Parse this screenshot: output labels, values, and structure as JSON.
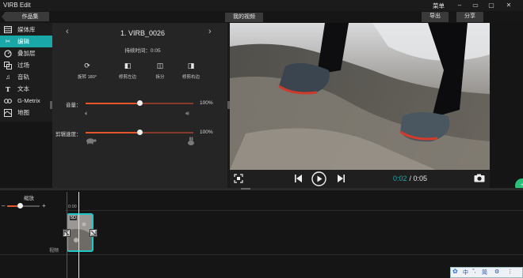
{
  "app": {
    "title": "VIRB Edit"
  },
  "window": {
    "menu_label": "菜单",
    "minimize": "–",
    "restore": "▭",
    "maximize": "▢",
    "close": "✕"
  },
  "tabs": {
    "back_label": "作品集",
    "my_videos": "我的视频",
    "export": "导出",
    "share": "分享"
  },
  "sidebar": {
    "items": [
      {
        "label": "媒体库",
        "icon": "media-library-icon",
        "active": false
      },
      {
        "label": "编辑",
        "icon": "scissors-icon",
        "active": true
      },
      {
        "label": "叠加层",
        "icon": "gauge-icon",
        "active": false
      },
      {
        "label": "过场",
        "icon": "transition-icon",
        "active": false
      },
      {
        "label": "音轨",
        "icon": "music-icon",
        "active": false
      },
      {
        "label": "文本",
        "icon": "text-icon",
        "active": false
      },
      {
        "label": "G-Metrix",
        "icon": "gmetrix-icon",
        "active": false
      },
      {
        "label": "地图",
        "icon": "map-icon",
        "active": false
      }
    ]
  },
  "editor": {
    "clip_title": "1. VIRB_0026",
    "duration": "持续时间：0:05",
    "tools": [
      "旋转 180°",
      "修剪左边",
      "拆分",
      "修剪右边"
    ],
    "volume": {
      "label": "音量：",
      "value": "100%",
      "fraction": 0.5
    },
    "speed": {
      "label": "剪辑速度：",
      "value": "100%",
      "fraction": 0.5
    }
  },
  "player": {
    "current_time": "0:02",
    "total_time": " / 0:05"
  },
  "timeline": {
    "zoom_label": "缩放",
    "zoom_fraction": 0.4,
    "time_marker": "0:00",
    "track_label": "视频",
    "clip_badge": "5D"
  },
  "taskbar": {
    "items": [
      "中",
      "°,",
      "简",
      "⚙",
      "⋮"
    ]
  },
  "colors": {
    "accent": "#1aa7a7",
    "slider": "#e8552a",
    "time_current": "#1aa7a7"
  }
}
